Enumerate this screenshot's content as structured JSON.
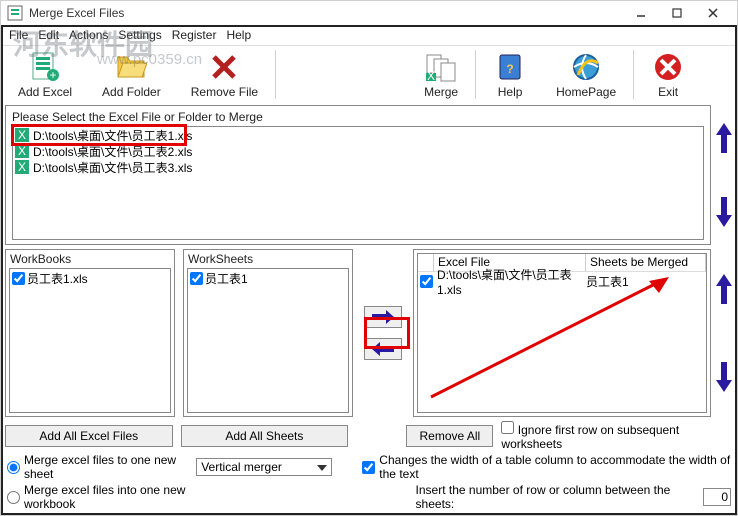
{
  "window": {
    "title": "Merge Excel Files"
  },
  "watermark": {
    "text": "河东软件园",
    "url": "www.pc0359.cn"
  },
  "menu": {
    "file": "File",
    "edit": "Edit",
    "actions": "Actions",
    "settings": "Settings",
    "register": "Register",
    "help": "Help"
  },
  "toolbar": {
    "add_excel": "Add Excel",
    "add_folder": "Add Folder",
    "remove_file": "Remove File",
    "merge": "Merge",
    "help": "Help",
    "homepage": "HomePage",
    "exit": "Exit"
  },
  "file_section_title": "Please Select the Excel File or Folder to Merge",
  "files": [
    "D:\\tools\\桌面\\文件\\员工表1.xls",
    "D:\\tools\\桌面\\文件\\员工表2.xls",
    "D:\\tools\\桌面\\文件\\员工表3.xls"
  ],
  "panels": {
    "workbooks": {
      "title": "WorkBooks",
      "item": "员工表1.xls"
    },
    "worksheets": {
      "title": "WorkSheets",
      "item": "员工表1"
    },
    "excel_file": {
      "title": "Excel File",
      "item": "D:\\tools\\桌面\\文件\\员工表1.xls"
    },
    "sheets_merged": {
      "title": "Sheets be Merged",
      "item": "员工表1"
    }
  },
  "buttons": {
    "add_all_excel": "Add All Excel Files",
    "add_all_sheets": "Add All Sheets",
    "remove_all": "Remove All"
  },
  "options": {
    "ignore_first_row": "Ignore first row on subsequent worksheets",
    "merge_one_sheet": "Merge excel files to one new sheet",
    "merge_one_workbook": "Merge excel files into one new workbook",
    "merger_mode": "Vertical merger",
    "changes_width": "Changes the width of a table column to accommodate the width of the text",
    "insert_number_label": "Insert the number of row or column between the sheets:",
    "insert_number_value": "0"
  }
}
